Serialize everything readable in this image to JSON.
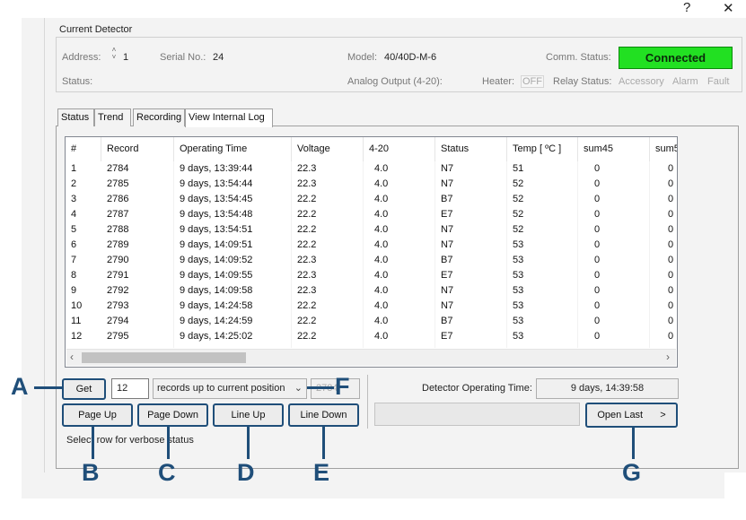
{
  "titlebar": {
    "help_label": "?",
    "close_label": "✕"
  },
  "detector": {
    "group_title": "Current Detector",
    "address_label": "Address:",
    "address_value": "1",
    "serial_label": "Serial No.:",
    "serial_value": "24",
    "model_label": "Model:",
    "model_value": "40/40D-M-6",
    "comm_label": "Comm. Status:",
    "comm_value": "Connected",
    "comm_color": "#22e022",
    "status_label": "Status:",
    "analog_label": "Analog Output (4-20):",
    "heater_label": "Heater:",
    "heater_value": "OFF",
    "relay_label": "Relay Status:",
    "relay_items": [
      "Accessory",
      "Alarm",
      "Fault"
    ]
  },
  "tabs": [
    {
      "label": "Status"
    },
    {
      "label": "Trend"
    },
    {
      "label": "Recording"
    },
    {
      "label": "View Internal Log"
    }
  ],
  "log_table": {
    "columns": [
      "#",
      "Record",
      "Operating Time",
      "Voltage",
      "4-20",
      "Status",
      "Temp [ ºC ]",
      "sum45",
      "sum5"
    ],
    "rows": [
      [
        "1",
        "2784",
        "9 days, 13:39:44",
        "22.3",
        "4.0",
        "N7",
        "51",
        "0",
        "0"
      ],
      [
        "2",
        "2785",
        "9 days, 13:54:44",
        "22.3",
        "4.0",
        "N7",
        "52",
        "0",
        "0"
      ],
      [
        "3",
        "2786",
        "9 days, 13:54:45",
        "22.2",
        "4.0",
        "B7",
        "52",
        "0",
        "0"
      ],
      [
        "4",
        "2787",
        "9 days, 13:54:48",
        "22.2",
        "4.0",
        "E7",
        "52",
        "0",
        "0"
      ],
      [
        "5",
        "2788",
        "9 days, 13:54:51",
        "22.2",
        "4.0",
        "N7",
        "52",
        "0",
        "0"
      ],
      [
        "6",
        "2789",
        "9 days, 14:09:51",
        "22.2",
        "4.0",
        "N7",
        "53",
        "0",
        "0"
      ],
      [
        "7",
        "2790",
        "9 days, 14:09:52",
        "22.3",
        "4.0",
        "B7",
        "53",
        "0",
        "0"
      ],
      [
        "8",
        "2791",
        "9 days, 14:09:55",
        "22.3",
        "4.0",
        "E7",
        "53",
        "0",
        "0"
      ],
      [
        "9",
        "2792",
        "9 days, 14:09:58",
        "22.3",
        "4.0",
        "N7",
        "53",
        "0",
        "0"
      ],
      [
        "10",
        "2793",
        "9 days, 14:24:58",
        "22.2",
        "4.0",
        "N7",
        "53",
        "0",
        "0"
      ],
      [
        "11",
        "2794",
        "9 days, 14:24:59",
        "22.2",
        "4.0",
        "B7",
        "53",
        "0",
        "0"
      ],
      [
        "12",
        "2795",
        "9 days, 14:25:02",
        "22.2",
        "4.0",
        "E7",
        "53",
        "0",
        "0"
      ]
    ]
  },
  "controls": {
    "get_label": "Get",
    "count_value": "12",
    "mode_value": "records up to current position",
    "position_value": "2784",
    "page_up_label": "Page Up",
    "page_down_label": "Page Down",
    "line_up_label": "Line Up",
    "line_down_label": "Line Down",
    "open_last_label": "Open Last",
    "open_last_arrow": ">",
    "operating_time_label": "Detector Operating Time:",
    "operating_time_value": "9 days, 14:39:58",
    "hint_text": "Select row for verbose status"
  },
  "callouts": [
    "A",
    "B",
    "C",
    "D",
    "E",
    "F",
    "G"
  ],
  "accent_color": "#1f4e79"
}
